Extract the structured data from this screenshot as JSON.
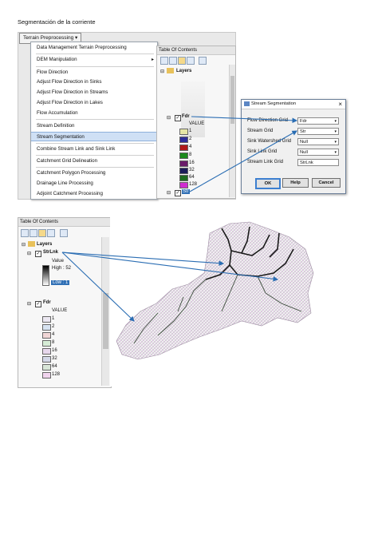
{
  "page_title": "Segmentación de la corriente",
  "terrain_menu": {
    "header": "Terrain Preprocessing",
    "header_caret": "▾",
    "items": [
      "Data Management Terrain Preprocessing",
      "DEM Manipulation",
      "Flow Direction",
      "Adjust Flow Direction in Sinks",
      "Adjust Flow Direction in Streams",
      "Adjust Flow Direction in Lakes",
      "Flow Accumulation",
      "Stream Definition",
      "Stream Segmentation",
      "Combine Stream Link and Sink Link",
      "Catchment Grid Delineation",
      "Catchment Polygon Processing",
      "Drainage Line Processing",
      "Adjoint Catchment Processing"
    ],
    "selected": "Stream Segmentation",
    "submenu_arrow": "▸"
  },
  "toc_top": {
    "title": "Table Of Contents",
    "layers": "Layers",
    "fdr_layer": "Fdr",
    "value_header": "VALUE",
    "values": [
      "1",
      "2",
      "4",
      "8",
      "16",
      "32",
      "64",
      "128"
    ],
    "colors": [
      "#e6e6a6",
      "#2e2e9a",
      "#b01919",
      "#1c8a1c",
      "#6a1c6a",
      "#1c1c5a",
      "#1f6b1f",
      "#d02cd0"
    ],
    "strlnk_short": "Str"
  },
  "dialog": {
    "title": "Stream Segmentation",
    "rows": [
      {
        "label": "Flow Direction Grid",
        "value": "Fdr"
      },
      {
        "label": "Stream Grid",
        "value": "Str"
      },
      {
        "label": "Sink Watershed Grid",
        "value": "Null"
      },
      {
        "label": "Sink Link Grid",
        "value": "Null"
      }
    ],
    "output_label": "Stream Link Grid",
    "output_value": "StrLnk",
    "ok": "OK",
    "help": "Help",
    "cancel": "Cancel"
  },
  "toc_bottom": {
    "title": "Table Of Contents",
    "layers": "Layers",
    "strlnk_layer": "StrLnk",
    "value_label": "Value",
    "high_label": "High : 52",
    "low_label": "Low : 1",
    "fdr_layer": "Fdr",
    "value_header": "VALUE",
    "values": [
      "1",
      "2",
      "4",
      "8",
      "16",
      "32",
      "64",
      "128"
    ],
    "colors": [
      "#ece8f2",
      "#d7e3f1",
      "#f1d6d6",
      "#d6ecd6",
      "#e7d7ec",
      "#d4d8e8",
      "#d8e6d8",
      "#f1d4ee"
    ]
  }
}
